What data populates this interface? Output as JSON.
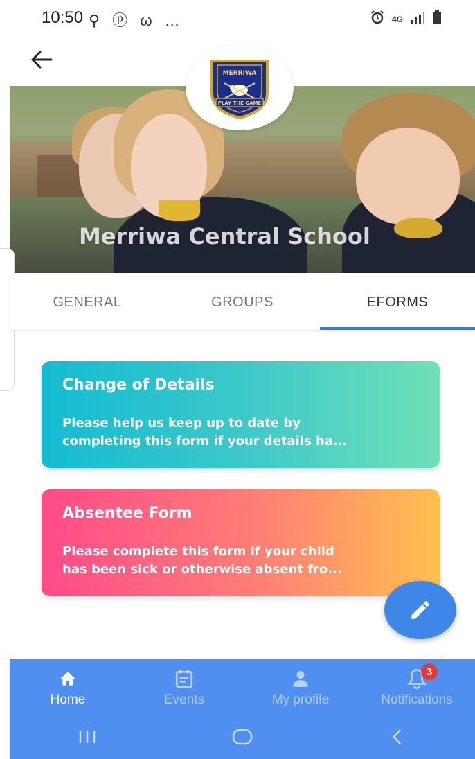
{
  "status_bar": {
    "time": "10:50",
    "notification_icons": "⚲ ⓟ ω …",
    "network": "4G"
  },
  "school": {
    "name": "Merriwa Central School",
    "logo_top_text": "MERRIWA",
    "logo_motto": "PLAY THE GAME"
  },
  "tabs": [
    {
      "label": "GENERAL",
      "active": false
    },
    {
      "label": "GROUPS",
      "active": false
    },
    {
      "label": "EFORMS",
      "active": true
    }
  ],
  "forms": [
    {
      "title": "Change of Details",
      "description_line1": "Please help us keep up to date by",
      "description_line2": "completing this form if your details ha..."
    },
    {
      "title": "Absentee Form",
      "description_line1": "Please complete this form if your child",
      "description_line2": "has been sick or otherwise absent fro..."
    }
  ],
  "bottom_nav": [
    {
      "label": "Home",
      "icon": "home-icon",
      "active": true
    },
    {
      "label": "Events",
      "icon": "calendar-icon",
      "active": false
    },
    {
      "label": "My profile",
      "icon": "person-icon",
      "active": false
    },
    {
      "label": "Notifications",
      "icon": "bell-icon",
      "active": false,
      "badge": "3"
    }
  ],
  "colors": {
    "accent": "#3a79d6",
    "nav_bg": "#4f8ff0",
    "fab": "#3e86e8",
    "badge": "#e53935"
  }
}
